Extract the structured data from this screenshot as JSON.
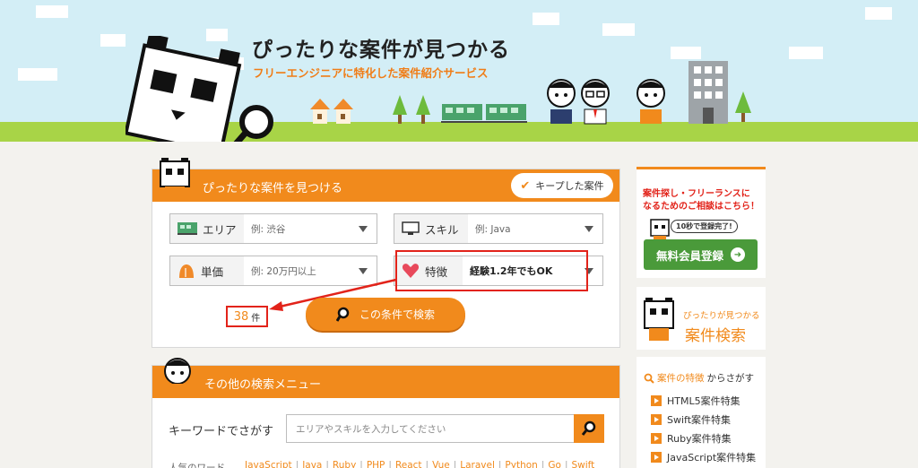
{
  "header": {
    "title": "ぴったりな案件が見つかる",
    "subtitle": "フリーエンジニアに特化した案件紹介サービス"
  },
  "search": {
    "title": "ぴったりな案件を見つける",
    "kept_label": "キープした案件",
    "area": {
      "label": "エリア",
      "value": "例: 渋谷"
    },
    "skill": {
      "label": "スキル",
      "value": "例: Java"
    },
    "price": {
      "label": "単価",
      "value": "例: 20万円以上"
    },
    "feature": {
      "label": "特徴",
      "value": "経験1.2年でもOK"
    },
    "count": "38",
    "count_unit": "件",
    "search_button": "この条件で検索"
  },
  "other": {
    "title": "その他の検索メニュー",
    "keyword_label": "キーワードでさがす",
    "keyword_placeholder": "エリアやスキルを入力してください",
    "popular_label": "人気のワード",
    "popular_words": [
      "JavaScript",
      "Java",
      "Ruby",
      "PHP",
      "React",
      "Vue",
      "Laravel",
      "Python",
      "Go",
      "Swift"
    ]
  },
  "sidebar": {
    "consult_line1": "案件探し・フリーランスに",
    "consult_line2": "なるためのご相談はこちら！",
    "bubble": "10秒で登録完了!",
    "register_button": "無料会員登録",
    "search_small": "ぴったりが見つかる",
    "search_big": "案件検索",
    "feature_title_hl": "案件の特徴",
    "feature_title_rest": "からさがす",
    "features": [
      "HTML5案件特集",
      "Swift案件特集",
      "Ruby案件特集",
      "JavaScript案件特集"
    ]
  },
  "colors": {
    "accent": "#f18a1c",
    "highlight": "#e2231a",
    "green": "#4a9a3a"
  }
}
